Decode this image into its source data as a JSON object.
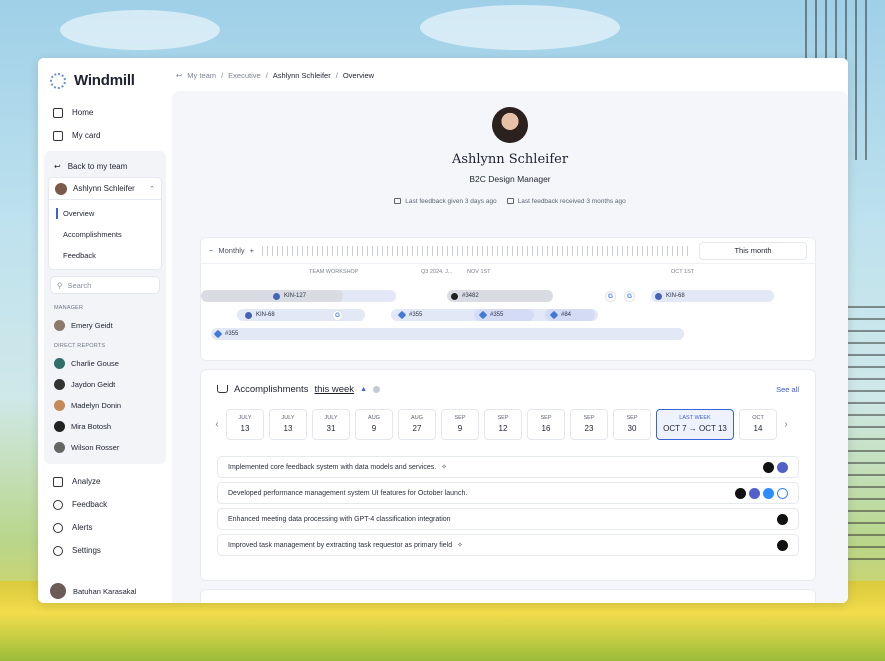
{
  "app": {
    "name": "Windmill"
  },
  "sidebar": {
    "nav": [
      {
        "label": "Home",
        "icon": "home-icon"
      },
      {
        "label": "My card",
        "icon": "card-icon"
      }
    ],
    "back_label": "Back to my team",
    "selected_person": "Ashlynn Schleifer",
    "sub_items": [
      "Overview",
      "Accomplishments",
      "Feedback"
    ],
    "search_placeholder": "Search",
    "manager_label": "MANAGER",
    "manager": "Emery Geidt",
    "reports_label": "DIRECT REPORTS",
    "reports": [
      "Charlie Gouse",
      "Jaydon Geidt",
      "Madelyn Donin",
      "Mira Botosh",
      "Wilson Rosser"
    ],
    "nav2": [
      {
        "label": "Analyze",
        "icon": "chart-icon"
      },
      {
        "label": "Feedback",
        "icon": "feedback-icon"
      },
      {
        "label": "Alerts",
        "icon": "bell-icon"
      },
      {
        "label": "Settings",
        "icon": "gear-icon"
      }
    ],
    "current_user": "Batuhan Karasakal"
  },
  "breadcrumb": [
    "My team",
    "Executive",
    "Ashlynn Schleifer",
    "Overview"
  ],
  "profile": {
    "name": "Ashlynn Schleifer",
    "role": "B2C Design Manager",
    "feedback_given": "Last feedback given 3 days ago",
    "feedback_received": "Last feedback received 3 months ago"
  },
  "timeline": {
    "scale": "Monthly",
    "minus": "−",
    "plus": "+",
    "range": "This month",
    "labels": [
      "TEAM WORKSHOP",
      "Q3 2024, J...",
      "NOV 1ST",
      "OCT 1ST"
    ],
    "items": [
      "KIN-127",
      "#3482",
      "KIN-68",
      "KIN-68",
      "#355",
      "#355",
      "#84",
      "#355"
    ]
  },
  "accomplishments": {
    "title_prefix": "Accomplishments",
    "title_period": "this week",
    "see_all": "See all",
    "weeks": [
      {
        "month": "JULY",
        "day": "13"
      },
      {
        "month": "JULY",
        "day": "13"
      },
      {
        "month": "JULY",
        "day": "31"
      },
      {
        "month": "AUG",
        "day": "9"
      },
      {
        "month": "AUG",
        "day": "27"
      },
      {
        "month": "SEP",
        "day": "9"
      },
      {
        "month": "SEP",
        "day": "12"
      },
      {
        "month": "SEP",
        "day": "16"
      },
      {
        "month": "SEP",
        "day": "23"
      },
      {
        "month": "SEP",
        "day": "30"
      },
      {
        "month": "LAST WEEK",
        "day": "OCT 7 → OCT 13"
      },
      {
        "month": "OCT",
        "day": "14"
      }
    ],
    "items": [
      "Implemented core feedback system with data models and services.",
      "Developed performance management system UI features for October launch.",
      "Enhanced meeting data processing with GPT-4 classification integration",
      "Improved task management by extracting task requestor as primary field"
    ]
  },
  "colors": {
    "accent": "#3a63d8",
    "background": "#f4f6f9"
  }
}
